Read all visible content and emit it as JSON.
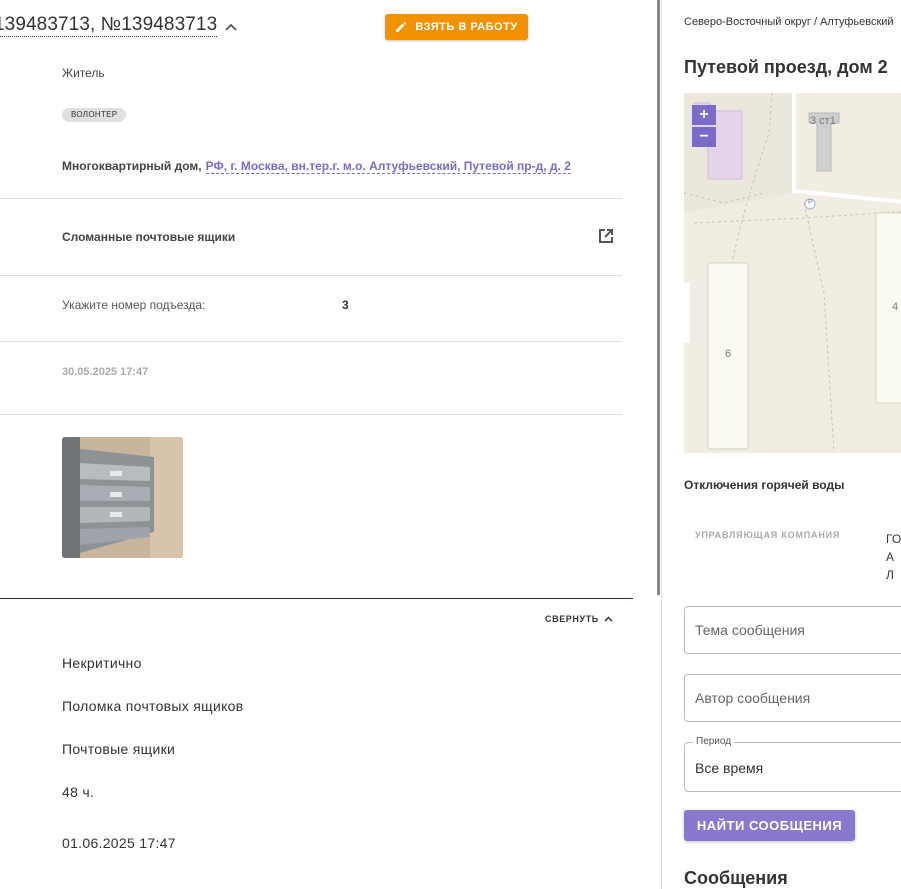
{
  "ticket": {
    "title": "139483713, №139483713",
    "take_button": "ВЗЯТЬ В РАБОТУ",
    "role": "Житель",
    "badge": "ВОЛОНТЕР",
    "address_prefix": "Многоквартирный дом,",
    "address_link": "РФ, г. Москва, вн.тер.г. м.о. Алтуфьевский, Путевой пр-д, д. 2",
    "problem": "Сломанные почтовые ящики",
    "question_label": "Укажите номер подъезда:",
    "question_value": "3",
    "created": "30.05.2025 17:47",
    "collapse_label": "СВЕРНУТЬ",
    "details": {
      "priority": "Некритично",
      "category": "Поломка почтовых ящиков",
      "subcategory": "Почтовые ящики",
      "deadline": "48 ч.",
      "due_date": "01.06.2025 17:47"
    }
  },
  "side": {
    "breadcrumb": "Северо-Восточный округ / Алтуфьевский",
    "title": "Путевой проезд, дом 2",
    "map": {
      "zoom_in": "+",
      "zoom_out": "−",
      "label_bld": "3 ст1",
      "label_6": "6",
      "label_4": "4",
      "label_p": "P"
    },
    "outage_title": "Отключения горячей воды",
    "mc_label": "УПРАВЛЯЮЩАЯ КОМПАНИЯ",
    "mc_value": "ГО АЛ",
    "subject_placeholder": "Тема сообщения",
    "author_placeholder": "Автор сообщения",
    "period_label": "Период",
    "period_value": "Все время",
    "find_button": "НАЙТИ СООБЩЕНИЯ",
    "messages_title": "Сообщения"
  },
  "colors": {
    "accent_orange": "#f39200",
    "accent_purple": "#7b6bc8",
    "button_purple": "#8a78cf"
  }
}
